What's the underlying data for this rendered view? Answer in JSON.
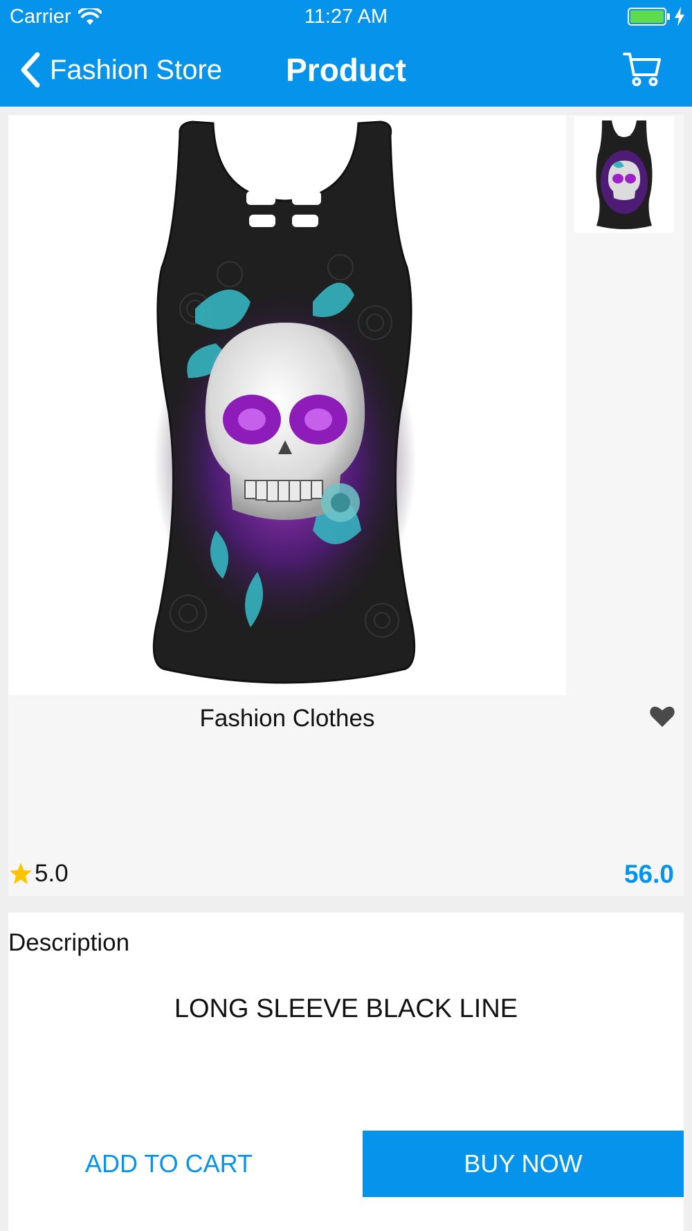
{
  "status_bar": {
    "carrier": "Carrier",
    "time": "11:27 AM",
    "battery_level": 1.0
  },
  "nav": {
    "back_label": "Fashion Store",
    "title": "Product",
    "back_icon": "chevron-left-icon",
    "cart_icon": "cart-icon"
  },
  "product": {
    "name": "Fashion Clothes",
    "rating": "5.0",
    "price": "56.0",
    "image": "skull-print-tank-top",
    "favorite_icon": "heart-icon",
    "rating_icon": "star-icon"
  },
  "description": {
    "heading": "Description",
    "text": "LONG SLEEVE BLACK LINE"
  },
  "actions": {
    "add_to_cart": "ADD TO CART",
    "buy_now": "BUY NOW"
  },
  "colors": {
    "accent": "#0693ec",
    "star": "#ffc400",
    "battery": "#5fdc4b"
  }
}
